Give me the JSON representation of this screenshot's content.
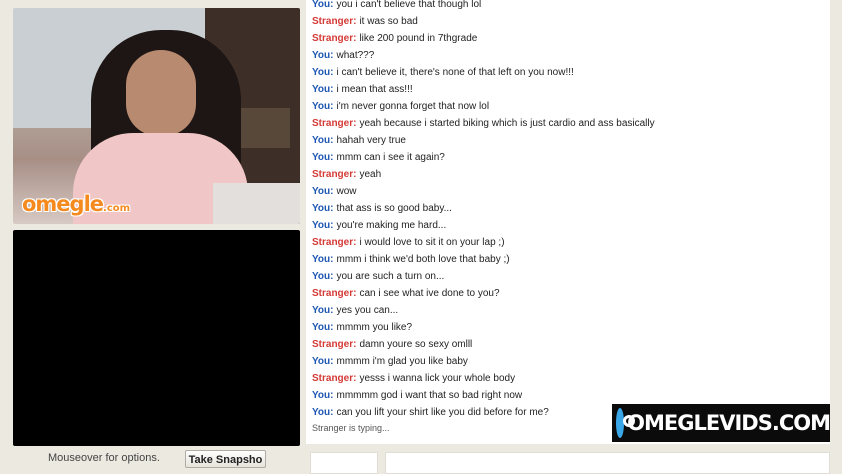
{
  "branding": {
    "logo_text": "omegle",
    "logo_suffix": ".com",
    "watermark_text": "OMEGLEVIDS.COM"
  },
  "controls": {
    "mouseover_text": "Mouseover for options.",
    "snapshot_label": "Take Snapsho"
  },
  "chat": {
    "messages": [
      {
        "who": "You:",
        "text": "you i can't believe that though lol"
      },
      {
        "who": "Stranger:",
        "text": "it was so bad"
      },
      {
        "who": "Stranger:",
        "text": "like 200 pound in 7thgrade"
      },
      {
        "who": "You:",
        "text": "what???"
      },
      {
        "who": "You:",
        "text": "i can't believe it, there's none of that left on you now!!!"
      },
      {
        "who": "You:",
        "text": "i mean that ass!!!"
      },
      {
        "who": "You:",
        "text": "i'm never gonna forget that now lol"
      },
      {
        "who": "Stranger:",
        "text": "yeah because i started biking which is just cardio and ass basically"
      },
      {
        "who": "You:",
        "text": "hahah very true"
      },
      {
        "who": "You:",
        "text": "mmm can i see it again?"
      },
      {
        "who": "Stranger:",
        "text": "yeah"
      },
      {
        "who": "You:",
        "text": "wow"
      },
      {
        "who": "You:",
        "text": "that ass is so good baby..."
      },
      {
        "who": "You:",
        "text": "you're making me hard..."
      },
      {
        "who": "Stranger:",
        "text": "i would love to sit it on your lap ;)"
      },
      {
        "who": "You:",
        "text": "mmm i think we'd both love that baby ;)"
      },
      {
        "who": "You:",
        "text": "you are such a turn on..."
      },
      {
        "who": "Stranger:",
        "text": "can i see what ive done to you?"
      },
      {
        "who": "You:",
        "text": "yes you can..."
      },
      {
        "who": "You:",
        "text": "mmmm you like?"
      },
      {
        "who": "Stranger:",
        "text": "damn youre so sexy omlll"
      },
      {
        "who": "You:",
        "text": "mmmm i'm glad you like baby"
      },
      {
        "who": "Stranger:",
        "text": "yesss i wanna lick your whole body"
      },
      {
        "who": "You:",
        "text": "mmmmm god i want that so bad right now"
      },
      {
        "who": "You:",
        "text": "can you lift your shirt like you did before for me?"
      }
    ],
    "typing_status": "Stranger is typing..."
  },
  "colors": {
    "you": "#1e57b2",
    "stranger": "#d43a36",
    "logo": "#f58a1f",
    "watermark_icon": "#3aa7e8"
  }
}
